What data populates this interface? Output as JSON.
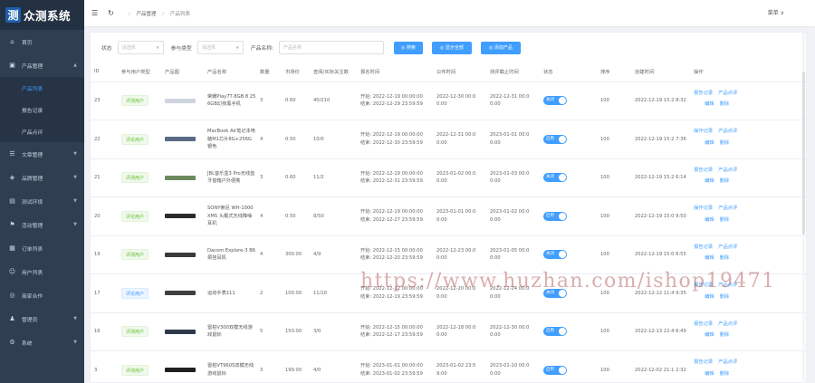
{
  "app": {
    "logo_mark": "测",
    "title": "众测系统"
  },
  "sidebar": {
    "items": [
      {
        "label": "首页",
        "icon": "home-icon",
        "glyph": "⌂",
        "has_children": false
      },
      {
        "label": "产品管理",
        "icon": "box-icon",
        "glyph": "▣",
        "has_children": true,
        "expanded": true,
        "children": [
          {
            "label": "产品列表",
            "active": true
          },
          {
            "label": "报告记录",
            "active": false
          },
          {
            "label": "产品点评",
            "active": false
          }
        ]
      },
      {
        "label": "文章管理",
        "icon": "document-icon",
        "glyph": "☰",
        "has_children": true
      },
      {
        "label": "品牌管理",
        "icon": "tag-icon",
        "glyph": "◈",
        "has_children": true
      },
      {
        "label": "测试环境",
        "icon": "flask-icon",
        "glyph": "▤",
        "has_children": true
      },
      {
        "label": "活动管理",
        "icon": "flag-icon",
        "glyph": "⚑",
        "has_children": true
      },
      {
        "label": "订单列表",
        "icon": "order-icon",
        "glyph": "▦",
        "has_children": false
      },
      {
        "label": "用户列表",
        "icon": "user-icon",
        "glyph": "☺",
        "has_children": false
      },
      {
        "label": "商家合作",
        "icon": "handshake-icon",
        "glyph": "◎",
        "has_children": false
      },
      {
        "label": "管理员",
        "icon": "admin-icon",
        "glyph": "♟",
        "has_children": true
      },
      {
        "label": "系统",
        "icon": "gear-icon",
        "glyph": "⚙",
        "has_children": true
      }
    ]
  },
  "topbar": {
    "breadcrumb": [
      "产品管理",
      "产品列表"
    ],
    "user_menu": "菜单 ∨"
  },
  "filters": {
    "status_label": "状态",
    "status_placeholder": "请选择",
    "type_label": "参与类型",
    "type_placeholder": "请选择",
    "name_label": "产品名称:",
    "name_placeholder": "产品名称",
    "search_btn": "◎ 搜索",
    "show_all_btn": "◎ 显示全部",
    "add_btn": "◎ 添加产品"
  },
  "table": {
    "headers": [
      "ID",
      "参与用户类型",
      "产品图",
      "产品名称",
      "数量",
      "市场价",
      "查阅/实际关注数",
      "报名时间",
      "公布时间",
      "测评截止时间",
      "状态",
      "排序",
      "创建时间",
      "操作"
    ],
    "rows": [
      {
        "id": "23",
        "type": "评测用户",
        "type_color": "green",
        "thumb_color": "#cfd5de",
        "name": "荣耀Play7T·8GB 8 256GB幻夜黑手机",
        "qty": "3",
        "price": "0.60",
        "views": "40/210",
        "signup": [
          "开始: 2022-12-19 00:00:00",
          "结束: 2022-12-29 23:59:59"
        ],
        "publish": "2022-12-30 00:0 0:00",
        "deadline": "2022-12-31 00:0 0:00",
        "status": "关闭",
        "sort": "100",
        "created": "2022-12-19 15:2 8:32",
        "ops": [
          "报告记录",
          "产品点评",
          "编辑",
          "删除"
        ]
      },
      {
        "id": "22",
        "type": "评论用户",
        "type_color": "green",
        "thumb_color": "#5a6a85",
        "name": "MacBook Air笔记本电脑M1芯片8G+256G银色",
        "qty": "4",
        "price": "0.50",
        "views": "10/0",
        "signup": [
          "开始: 2022-12-19 00:00:00",
          "结束: 2022-12-30 23:59:59"
        ],
        "publish": "2022-12-31 00:0 0:00",
        "deadline": "2023-01-01 00:0 0:00",
        "status": "启用",
        "sort": "100",
        "created": "2022-12-19 15:2 7:36",
        "ops": [
          "操作记录",
          "产品点评",
          "编辑",
          "删除"
        ]
      },
      {
        "id": "21",
        "type": "评测用户",
        "type_color": "green",
        "thumb_color": "#6b8a5e",
        "name": "JBL音乐盒3 Pro无线蓝牙音箱户外便携",
        "qty": "3",
        "price": "0.60",
        "views": "11/2",
        "signup": [
          "开始: 2022-12-19 00:00:00",
          "结束: 2022-12-31 23:59:59"
        ],
        "publish": "2023-01-02 00:0 0:00",
        "deadline": "2023-01-03 00:0 0:00",
        "status": "关闭",
        "sort": "100",
        "created": "2022-12-19 15:2 6:14",
        "ops": [
          "报告记录",
          "产品点评",
          "编辑",
          "删除"
        ]
      },
      {
        "id": "20",
        "type": "评论用户",
        "type_color": "green",
        "thumb_color": "#2b2b2b",
        "name": "SONY索尼 WH-1000XM5 头戴式无线降噪耳机",
        "qty": "4",
        "price": "0.50",
        "views": "8/50",
        "signup": [
          "开始: 2022-12-19 00:00:00",
          "结束: 2022-12-27 23:59:59"
        ],
        "publish": "2023-01-01 00:0 0:00",
        "deadline": "2023-01-02 00:0 0:00",
        "status": "启用",
        "sort": "100",
        "created": "2022-12-19 15:0 9:50",
        "ops": [
          "操作记录",
          "产品点评",
          "编辑",
          "删除"
        ]
      },
      {
        "id": "19",
        "type": "评测用户",
        "type_color": "green",
        "thumb_color": "#3a3a3a",
        "name": "Dacom Explore-3 B6 颈挂耳机",
        "qty": "4",
        "price": "300.00",
        "views": "4/9",
        "signup": [
          "开始: 2022-12-15 00:00:00",
          "结束: 2022-12-20 23:59:59"
        ],
        "publish": "2022-12-23 00:0 0:00",
        "deadline": "2023-01-05 00:0 0:00",
        "status": "关闭",
        "sort": "100",
        "created": "2022-12-19 15:0 8:55",
        "ops": [
          "报告记录",
          "产品点评",
          "编辑",
          "删除"
        ]
      },
      {
        "id": "17",
        "type": "评论用户",
        "type_color": "blue",
        "thumb_color": "#404040",
        "name": "运动手表111",
        "qty": "2",
        "price": "100.00",
        "views": "11/10",
        "signup": [
          "开始: 2022-12-12 00:00:00",
          "结束: 2022-12-19 23:59:59"
        ],
        "publish": "2022-12-20 00:0 0:00",
        "deadline": "2022-12-24 00:0 0:00",
        "status": "关闭",
        "sort": "100",
        "created": "2022-12-12 11:4 9:35",
        "ops": [
          "报告记录",
          "产品点评",
          "编辑",
          "删除"
        ]
      },
      {
        "id": "16",
        "type": "评测用户",
        "type_color": "green",
        "thumb_color": "#2e3a4a",
        "name": "雷柏V300双模无线游戏鼠标",
        "qty": "5",
        "price": "150.00",
        "views": "3/0",
        "signup": [
          "开始: 2022-12-15 00:00:00",
          "结束: 2022-12-17 23:59:59"
        ],
        "publish": "2022-12-18 00:0 0:00",
        "deadline": "2022-12-30 00:0 0:00",
        "status": "启用",
        "sort": "100",
        "created": "2022-12-13 22:4 6:49",
        "ops": [
          "报告记录",
          "产品点评",
          "编辑",
          "删除"
        ]
      },
      {
        "id": "3",
        "type": "评测用户",
        "type_color": "green",
        "thumb_color": "#1f1f1f",
        "name": "雷柏VT960S双模无线游戏鼠标",
        "qty": "3",
        "price": "199.00",
        "views": "4/0",
        "signup": [
          "开始: 2023-01-01 00:00:00",
          "结束: 2023-01-02 23:59:59"
        ],
        "publish": "2023-01-02 23:5 9:00",
        "deadline": "2023-01-10 00:0 0:00",
        "status": "启用",
        "sort": "100",
        "created": "2022-12-02 21:1 2:32",
        "ops": [
          "报告记录",
          "产品点评",
          "编辑",
          "删除"
        ]
      }
    ]
  },
  "watermark": "https://www.huzhan.com/ishop19471",
  "colors": {
    "sidebar": "#2f3e51",
    "accent": "#409eff",
    "green": "#67c23a"
  }
}
